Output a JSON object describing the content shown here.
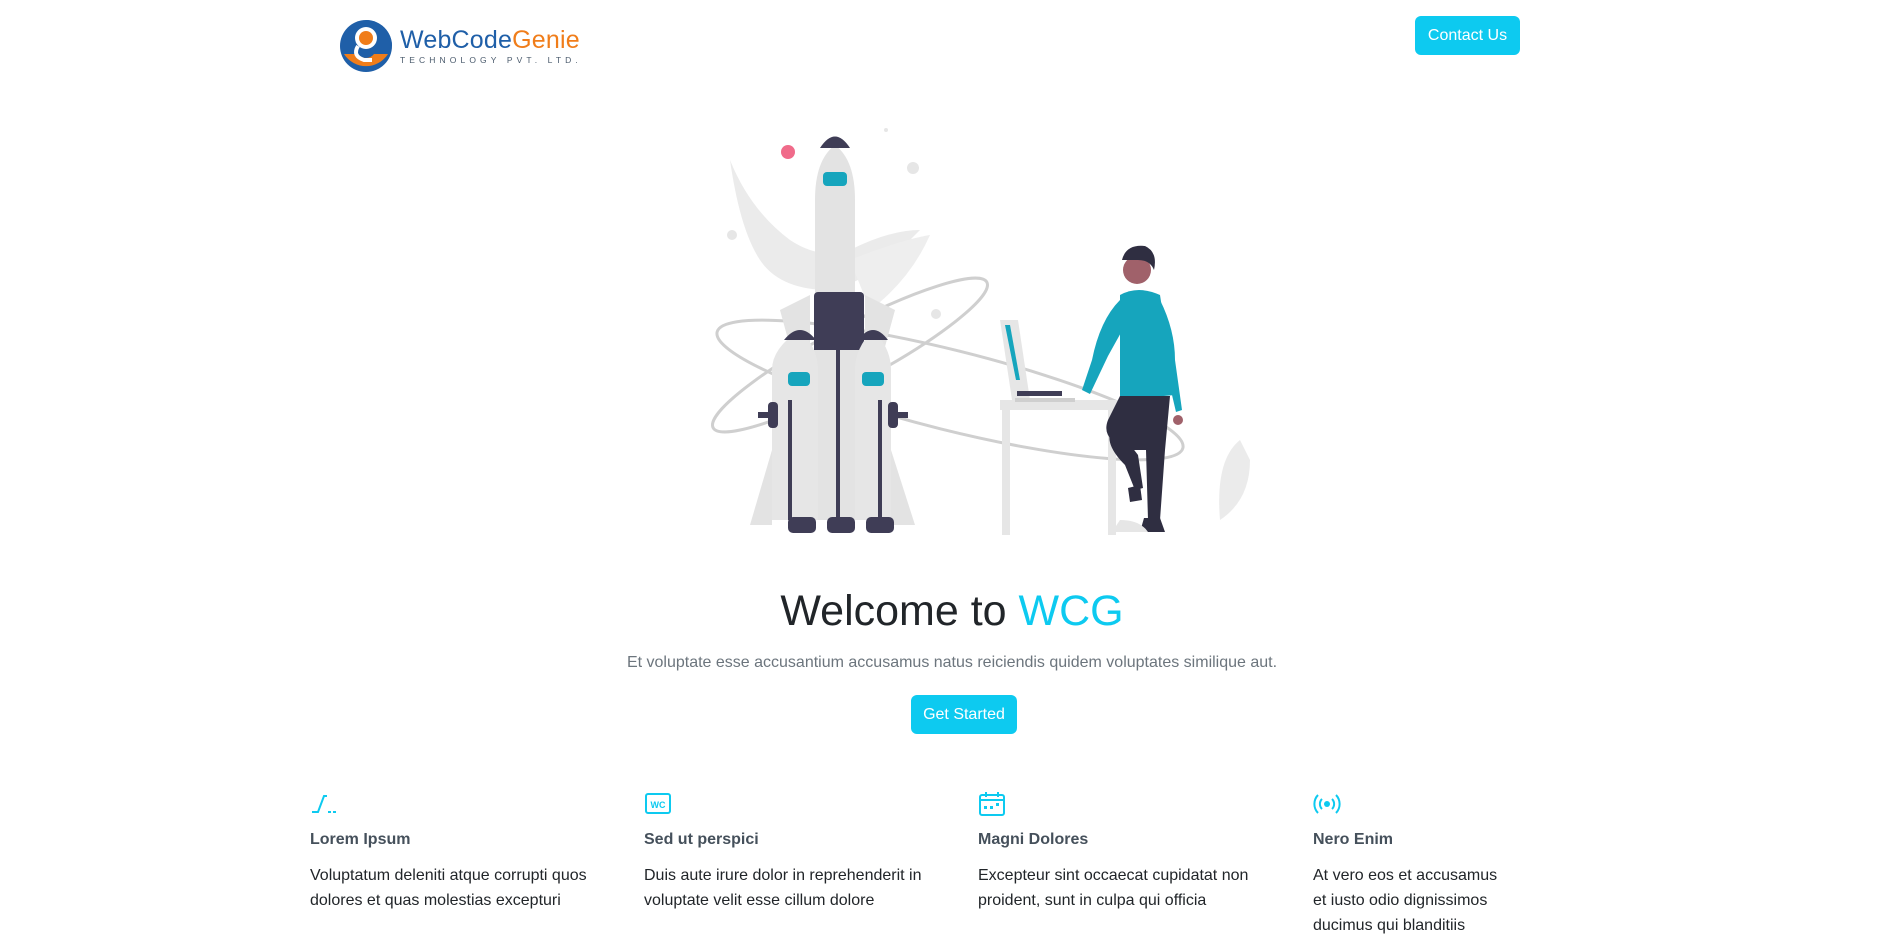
{
  "header": {
    "logo": {
      "title_part1": "WebCode",
      "title_part2": "Genie",
      "subtitle": "TECHNOLOGY PVT. LTD."
    },
    "contact_label": "Contact Us"
  },
  "hero": {
    "title_prefix": "Welcome to ",
    "title_accent": "WCG",
    "subtitle": "Et voluptate esse accusantium accusamus natus reiciendis quidem voluptates similique aut.",
    "cta_label": "Get Started"
  },
  "features": [
    {
      "icon": "activity-icon",
      "title": "Lorem Ipsum",
      "line1": "Voluptatum deleniti atque corrupti quos",
      "line2": "dolores et quas molestias excepturi",
      "line3": ""
    },
    {
      "icon": "wc-badge-icon",
      "title": "Sed ut perspici",
      "line1": "Duis aute irure dolor in reprehenderit in",
      "line2": "voluptate velit esse cillum dolore",
      "line3": ""
    },
    {
      "icon": "calendar-icon",
      "title": "Magni Dolores",
      "line1": "Excepteur sint occaecat cupidatat non",
      "line2": "proident, sunt in culpa qui officia",
      "line3": ""
    },
    {
      "icon": "broadcast-icon",
      "title": "Nero Enim",
      "line1": "At vero eos et accusamus",
      "line2": "et iusto odio dignissimos",
      "line3": "ducimus qui blanditiis"
    }
  ],
  "colors": {
    "accent": "#0dcaf0",
    "logo_blue": "#1f5fa8",
    "logo_orange": "#f07d1a",
    "text_muted": "#6c757d"
  }
}
